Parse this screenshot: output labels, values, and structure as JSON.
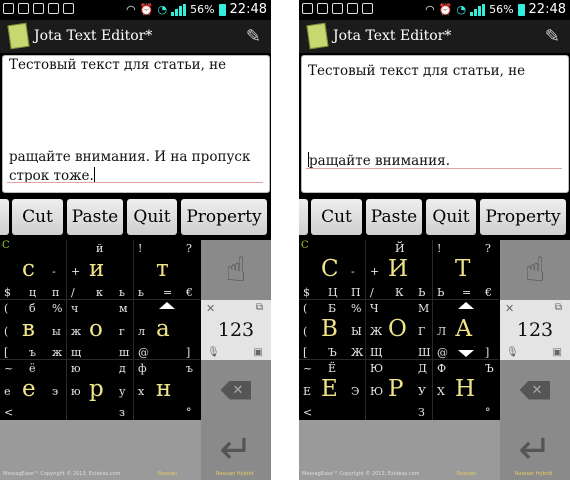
{
  "status_bar": {
    "battery": "56%",
    "time": "22:48"
  },
  "app": {
    "title": "Jota Text Editor*"
  },
  "toolbar": {
    "cut": "Cut",
    "paste": "Paste",
    "quit": "Quit",
    "property": "Property"
  },
  "screens": [
    {
      "editor_lines": [
        "Тестовый текст для статьи, не",
        "ращайте внимания. И на пропуск",
        "строк тоже."
      ]
    },
    {
      "editor_lines": [
        "Тестовый текст для статьи, не",
        "ращайте внимания."
      ]
    }
  ],
  "keyboard": {
    "layouts": [
      {
        "cells": [
          {
            "mk": "с",
            "tl": "",
            "tc": "",
            "tr": "",
            "ml": "",
            "mr": "-",
            "bl": "$",
            "bc": "ц",
            "br": "п",
            "g": "C"
          },
          {
            "mk": "и",
            "tl": "",
            "tc": "й",
            "tr": "",
            "ml": "+",
            "mr": "",
            "bl": "/",
            "bc": "к",
            "br": "ь"
          },
          {
            "mk": "т",
            "tl": "!",
            "tc": "",
            "tr": "?",
            "ml": "",
            "mr": "",
            "bl": "ь",
            "bc": "=",
            "br": "€"
          },
          {
            "mk": "в",
            "tl": "(",
            "tc": "б",
            "tr": "%",
            "ml": "(",
            "mr": "ы",
            "bl": "[",
            "bc": "ъ",
            "br": "ж"
          },
          {
            "mk": "о",
            "tl": "ч",
            "tc": "",
            "tr": "м",
            "ml": "ж",
            "mr": "г",
            "bl": "щ",
            "bc": "",
            "br": "ш"
          },
          {
            "mk": "а",
            "tl": "",
            "tc": "",
            "tr": "",
            "ml": "л",
            "mr": "",
            "bl": "@",
            "bc": "",
            "br": "]"
          },
          {
            "mk": "е",
            "tl": "~",
            "tc": "ё",
            "tr": "",
            "ml": "е",
            "mr": "э",
            "bl": "<",
            "bc": "",
            "br": ""
          },
          {
            "mk": "р",
            "tl": "ю",
            "tc": "",
            "tr": "д",
            "ml": "ю",
            "mr": "у",
            "bl": "",
            "bc": "",
            "br": "з"
          },
          {
            "mk": "н",
            "tl": "ф",
            "tc": "",
            "tr": "ъ",
            "ml": "х",
            "mr": "",
            "bl": "",
            "bc": "",
            "br": "°"
          }
        ]
      },
      {
        "cells": [
          {
            "mk": "С",
            "tl": "",
            "tc": "",
            "tr": "",
            "ml": "",
            "mr": "-",
            "bl": "$",
            "bc": "Ц",
            "br": "П",
            "g": "C"
          },
          {
            "mk": "И",
            "tl": "",
            "tc": "Й",
            "tr": "",
            "ml": "+",
            "mr": "",
            "bl": "/",
            "bc": "К",
            "br": "Ь"
          },
          {
            "mk": "Т",
            "tl": "!",
            "tc": "",
            "tr": "?",
            "ml": "",
            "mr": "",
            "bl": "Ь",
            "bc": "=",
            "br": "€"
          },
          {
            "mk": "В",
            "tl": "(",
            "tc": "Б",
            "tr": "%",
            "ml": "(",
            "mr": "Ы",
            "bl": "[",
            "bc": "Ъ",
            "br": "Ж"
          },
          {
            "mk": "О",
            "tl": "Ч",
            "tc": "",
            "tr": "М",
            "ml": "Ж",
            "mr": "Г",
            "bl": "Щ",
            "bc": "",
            "br": "Ш"
          },
          {
            "mk": "А",
            "tl": "",
            "tc": "",
            "tr": "",
            "ml": "Л",
            "mr": "",
            "bl": "@",
            "bc": "",
            "br": "]"
          },
          {
            "mk": "Е",
            "tl": "~",
            "tc": "Ё",
            "tr": "",
            "ml": "Е",
            "mr": "Э",
            "bl": "<",
            "bc": "",
            "br": ""
          },
          {
            "mk": "Р",
            "tl": "Ю",
            "tc": "",
            "tr": "Д",
            "ml": "Ю",
            "mr": "У",
            "bl": "",
            "bc": "",
            "br": "З"
          },
          {
            "mk": "Н",
            "tl": "Ф",
            "tc": "",
            "tr": "Ъ",
            "ml": "Х",
            "mr": "",
            "bl": "",
            "bc": "",
            "br": "°"
          }
        ]
      }
    ],
    "numpad_label": "123",
    "footer_left": "MessagEase™ Copyright © 2013, Exideas.com",
    "footer_mid": "Russian",
    "footer_right": "Russian Hybrid"
  }
}
